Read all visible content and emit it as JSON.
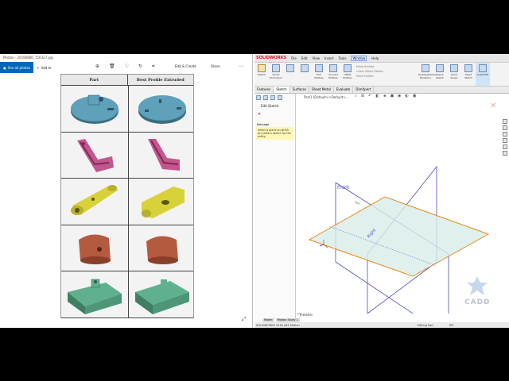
{
  "photos": {
    "title": "Photos - 20190806_150327.jpg",
    "see_all": "See all photos",
    "add_to": "Add to",
    "edit_create": "Edit & Create",
    "share": "Share",
    "table": {
      "col_part": "Part",
      "col_profile": "Best Profile Extruded"
    }
  },
  "solidworks": {
    "logo": "SOLIDWORKS",
    "menu": [
      "File",
      "Edit",
      "View",
      "Insert",
      "Tools",
      "Window",
      "Help"
    ],
    "ribbon": {
      "sketch": "Sketch",
      "smart_dimension": "Smart Dimension",
      "trim": "Trim Entities",
      "convert": "Convert Entities",
      "offset": "Offset Entities",
      "mirror": "Mirror Entities",
      "linear_pattern": "Linear Sketch Pattern",
      "move": "Move Entities",
      "display": "Display/Delete Relations",
      "repair": "Repair Sketch",
      "quick_snaps": "Quick Snaps",
      "rapid_sketch": "Rapid Sketch",
      "instant2d": "Instant2D"
    },
    "tabs": [
      "Features",
      "Sketch",
      "Surfaces",
      "Sheet Metal",
      "Evaluate",
      "DimXpert"
    ],
    "active_tab": "Sketch",
    "feature_manager": {
      "title": "Edit Sketch",
      "message_header": "Message",
      "message": "Select a plane on which to create a sketch for the entity."
    },
    "breadcrumb": "Part1 (Default<<Default>...",
    "view_label": "*Trimetric",
    "bottom_tabs": [
      "Model",
      "Motion Study 1"
    ],
    "planes": {
      "front": "Front",
      "top": "Top",
      "right": "Right"
    },
    "status": {
      "left": "SOLIDWORKS 2016 x64 Edition",
      "mode": "Editing Part",
      "units": "IPS"
    }
  },
  "watermark": "CADD"
}
